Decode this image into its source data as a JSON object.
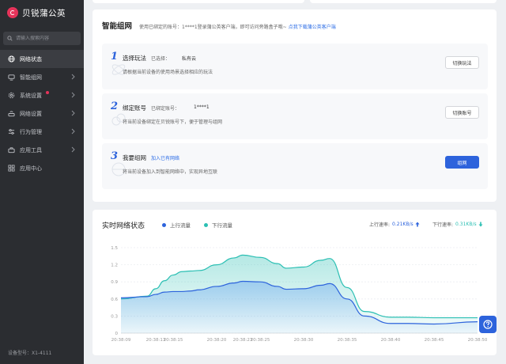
{
  "brand": {
    "name": "贝锐蒲公英"
  },
  "search": {
    "placeholder": "请输入搜索内容"
  },
  "nav": [
    {
      "label": "网络状态",
      "icon": "globe-icon",
      "active": true,
      "chevron": false
    },
    {
      "label": "智能组网",
      "icon": "network-icon",
      "active": false,
      "chevron": true
    },
    {
      "label": "系统设置",
      "icon": "gear-icon",
      "active": false,
      "chevron": true,
      "badge": true
    },
    {
      "label": "网络设置",
      "icon": "router-icon",
      "active": false,
      "chevron": true
    },
    {
      "label": "行为管理",
      "icon": "sliders-icon",
      "active": false,
      "chevron": true
    },
    {
      "label": "应用工具",
      "icon": "toolbox-icon",
      "active": false,
      "chevron": true
    },
    {
      "label": "应用中心",
      "icon": "grid-icon",
      "active": false,
      "chevron": false
    }
  ],
  "device": {
    "model": "设备型号：X1-4111"
  },
  "smart_network": {
    "title": "智能组网",
    "desc": "使用已绑定的账号：1****1登录蒲公英客户端，即可访问旁路盒子哦~",
    "link": "点我下载蒲公英客户端",
    "steps": [
      {
        "num": "1",
        "title": "选择玩法",
        "sub_label": "已选择：",
        "sub_value": "私有云",
        "desc": "请根据当前设备的使用场景选择相应的玩法",
        "button": "切换玩法"
      },
      {
        "num": "2",
        "title": "绑定账号",
        "sub_label": "已绑定账号：",
        "sub_value": "1****1",
        "desc": "将当前设备绑定在贝锐账号下，便于管理与组网",
        "button": "切换账号"
      },
      {
        "num": "3",
        "title": "我要组网",
        "link": "加入已有网络",
        "desc": "将当前设备加入到智能网络中，实现异地互联",
        "button": "组网"
      }
    ]
  },
  "realtime": {
    "title": "实时网络状态",
    "legend_up": "上行流量",
    "legend_down": "下行流量",
    "up_rate_label": "上行速率:",
    "up_rate_value": "0.21KB/s",
    "down_rate_label": "下行速率:",
    "down_rate_value": "0.31KB/s",
    "colors": {
      "up": "#2d63dc",
      "down": "#2bbfb3"
    }
  },
  "chart_data": {
    "type": "area",
    "title": "",
    "xlabel": "",
    "ylabel": "",
    "ylim": [
      0,
      1.5
    ],
    "yticks": [
      0,
      0.3,
      0.6,
      0.9,
      1.2,
      1.5
    ],
    "x": [
      "20:38:09",
      "20:38:12",
      "20:38:13",
      "20:38:14",
      "20:38:15",
      "20:38:16",
      "20:38:17",
      "20:38:18",
      "20:38:20",
      "20:38:22",
      "20:38:23",
      "20:38:25",
      "20:38:27",
      "20:38:28",
      "20:38:30",
      "20:38:32",
      "20:38:33",
      "20:38:35",
      "20:38:37",
      "20:38:40",
      "20:38:42",
      "20:38:45",
      "20:38:50"
    ],
    "xticks": [
      "20:38:09",
      "20:38:13",
      "20:38:15",
      "20:38:20",
      "20:38:23",
      "20:38:25",
      "20:38:30",
      "20:38:35",
      "20:38:40",
      "20:38:45",
      "20:38:50"
    ],
    "series": [
      {
        "name": "上行流量",
        "values": [
          0.62,
          0.64,
          0.68,
          0.72,
          0.73,
          0.73,
          0.74,
          0.76,
          0.82,
          0.88,
          0.91,
          0.9,
          0.82,
          0.77,
          0.78,
          0.84,
          0.87,
          0.6,
          0.3,
          0.17,
          0.17,
          0.16,
          0.2
        ]
      },
      {
        "name": "下行流量",
        "values": [
          0.6,
          0.65,
          0.78,
          0.92,
          1.02,
          1.08,
          1.09,
          1.1,
          1.2,
          1.32,
          1.37,
          1.33,
          1.22,
          1.14,
          1.16,
          1.28,
          1.31,
          0.8,
          0.38,
          0.28,
          0.28,
          0.27,
          0.27
        ]
      }
    ]
  }
}
